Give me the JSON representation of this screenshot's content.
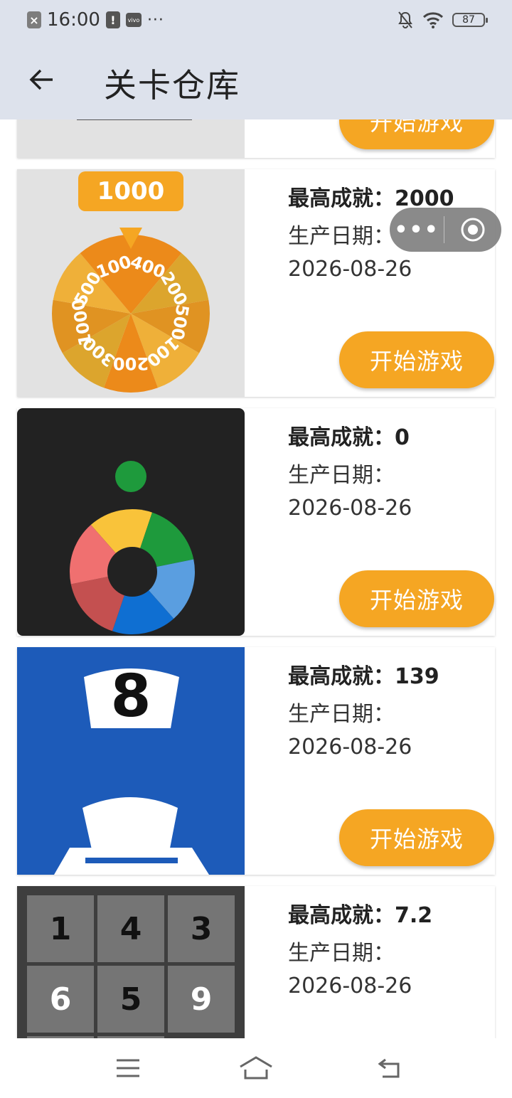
{
  "status_bar": {
    "time": "16:00",
    "notif_icon_1": "×",
    "notif_icon_2": "!",
    "notif_icon_3": "vivo",
    "more_dots": "···",
    "battery": "87"
  },
  "header": {
    "title": "关卡仓库",
    "back_icon": "arrow-left-icon"
  },
  "capsule": {
    "more_icon": "more-dots-icon",
    "close_icon": "record-circle-icon"
  },
  "cards": [
    {
      "button": "开始游戏"
    },
    {
      "best_label": "最高成就：",
      "best_value": "2000",
      "date_label": "生产日期：",
      "date_value": "2026-08-26",
      "button": "开始游戏",
      "thumb": {
        "badge": "1000",
        "wheel_labels": [
          "400",
          "200",
          "500",
          "100",
          "200",
          "300",
          "1000",
          "500",
          "100"
        ]
      }
    },
    {
      "best_label": "最高成就：",
      "best_value": "0",
      "date_label": "生产日期：",
      "date_value": "2026-08-26",
      "button": "开始游戏"
    },
    {
      "best_label": "最高成就：",
      "best_value": "139",
      "date_label": "生产日期：",
      "date_value": "2026-08-26",
      "button": "开始游戏",
      "thumb": {
        "number": "8"
      }
    },
    {
      "best_label": "最高成就：",
      "best_value": "7.2",
      "date_label": "生产日期：",
      "date_value": "2026-08-26",
      "thumb": {
        "grid": [
          "1",
          "4",
          "3",
          "6",
          "5",
          "9"
        ]
      }
    }
  ],
  "colors": {
    "accent": "#f5a623",
    "header_bg": "#dde2ec"
  },
  "navbar": {
    "menu_icon": "menu-icon",
    "home_icon": "home-icon",
    "back_icon": "back-icon"
  }
}
